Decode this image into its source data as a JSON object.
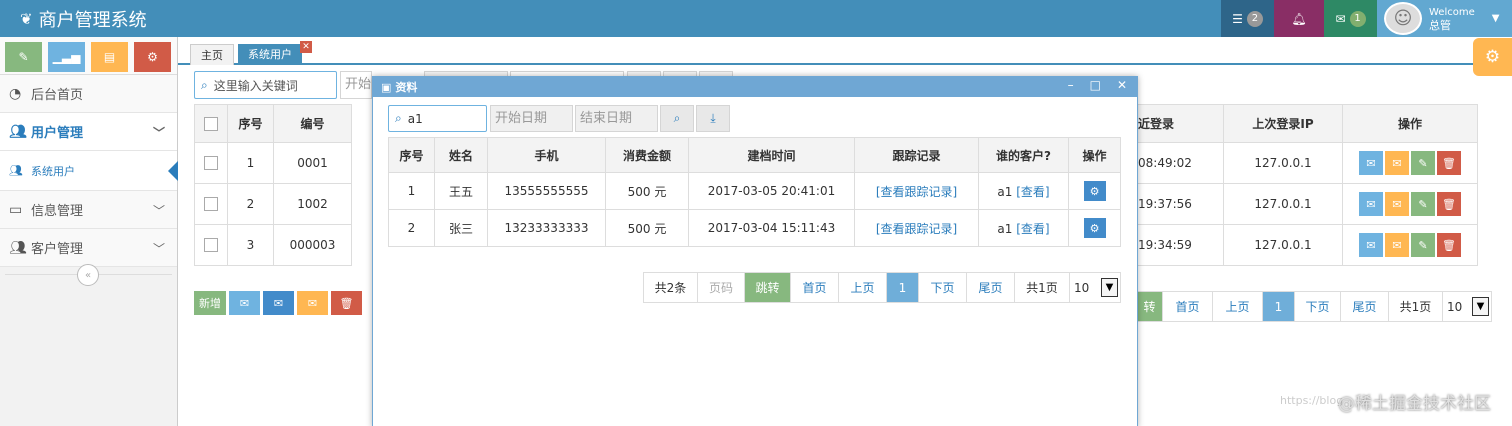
{
  "app": {
    "title": "商户管理系统"
  },
  "navbar": {
    "tasks_count": "2",
    "messages_count": "1",
    "welcome": "Welcome",
    "username": "总管"
  },
  "sidebar": {
    "items": [
      {
        "label": "后台首页"
      },
      {
        "label": "用户管理"
      },
      {
        "label": "系统用户"
      },
      {
        "label": "信息管理"
      },
      {
        "label": "客户管理"
      }
    ]
  },
  "tabs": [
    {
      "label": "主页"
    },
    {
      "label": "系统用户"
    }
  ],
  "main": {
    "search_placeholder": "这里输入关键词",
    "date_start_placeholder": "开始",
    "columns": [
      "序号",
      "编号"
    ],
    "rows": [
      {
        "index": "1",
        "code": "0001"
      },
      {
        "index": "2",
        "code": "1002"
      },
      {
        "index": "3",
        "code": "000003"
      }
    ],
    "right_columns": [
      "近登录",
      "上次登录IP",
      "操作"
    ],
    "right_rows": [
      {
        "login": "08:49:02",
        "ip": "127.0.0.1"
      },
      {
        "login": "19:37:56",
        "ip": "127.0.0.1"
      },
      {
        "login": "19:34:59",
        "ip": "127.0.0.1"
      }
    ],
    "add_label": "新增",
    "pager": {
      "jump": "转",
      "first": "首页",
      "prev": "上页",
      "current": "1",
      "next": "下页",
      "last": "尾页",
      "total_pages": "共1页",
      "size": "10"
    }
  },
  "dialog": {
    "title": "资料",
    "search_value": "a1",
    "start_placeholder": "开始日期",
    "end_placeholder": "结束日期",
    "columns": [
      "序号",
      "姓名",
      "手机",
      "消费金额",
      "建档时间",
      "跟踪记录",
      "谁的客户?",
      "操作"
    ],
    "rows": [
      {
        "index": "1",
        "name": "王五",
        "phone": "13555555555",
        "amount": "500 元",
        "created": "2017-03-05 20:41:01",
        "trace": "[查看跟踪记录]",
        "owner": "a1",
        "owner_link": "[查看]"
      },
      {
        "index": "2",
        "name": "张三",
        "phone": "13233333333",
        "amount": "500 元",
        "created": "2017-03-04 15:11:43",
        "trace": "[查看跟踪记录]",
        "owner": "a1",
        "owner_link": "[查看]"
      }
    ],
    "pager": {
      "total": "共2条",
      "page_input": "页码",
      "jump": "跳转",
      "first": "首页",
      "prev": "上页",
      "current": "1",
      "next": "下页",
      "last": "尾页",
      "total_pages": "共1页",
      "size": "10"
    }
  },
  "watermark": {
    "url": "https://blog",
    "text": "@稀土掘金技术社区"
  },
  "colors": {
    "navbar": "#438eb9",
    "accent_blue": "#2b7dbc",
    "green": "#87b87f",
    "orange": "#ffb752",
    "red": "#d15b47"
  }
}
